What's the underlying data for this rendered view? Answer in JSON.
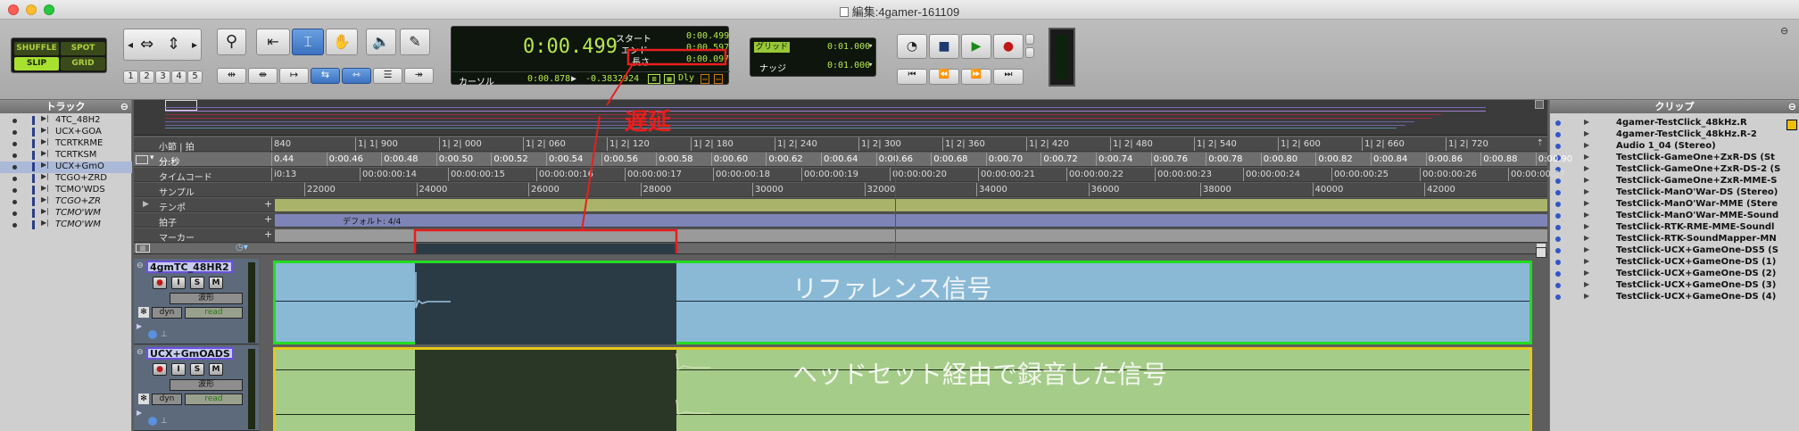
{
  "window": {
    "title": "編集:4gamer-161109"
  },
  "modes": {
    "shuffle": "SHUFFLE",
    "spot": "SPOT",
    "slip": "SLIP",
    "grid": "GRID"
  },
  "nudge_numbers": [
    "1",
    "2",
    "3",
    "4",
    "5"
  ],
  "counter": {
    "main": "0:00.499",
    "start_label": "スタート",
    "end_label": "エンド",
    "length_label": "長さ",
    "start": "0:00.499",
    "end": "0:00.597",
    "length": "0:00.097",
    "cursor_label": "カーソル",
    "cursor_time": "0:00.878",
    "cursor_value": "-0.3832924",
    "dly": "Dly"
  },
  "grid_nudge": {
    "grid_label": "グリッド",
    "grid_value": "0:01.000",
    "nudge_label": "ナッジ",
    "nudge_value": "0:01.000"
  },
  "tracks_panel": {
    "title": "トラック",
    "items": [
      "4TC_48H2",
      "UCX+GOA",
      "TCRTKRME",
      "TCRTKSM",
      "UCX+GmO",
      "TCGO+ZRD",
      "TCMO'WDS",
      "TCGO+ZR",
      "TCMO'WM",
      "TCMO'WM"
    ],
    "selected_index": 4
  },
  "clips_panel": {
    "title": "クリップ",
    "items": [
      "4gamer-TestClick_48kHz.R",
      "4gamer-TestClick_48kHz.R-2",
      "Audio 1_04 (Stereo)",
      "TestClick-GameOne+ZxR-DS (St",
      "TestClick-GameOne+ZxR-DS-2 (S",
      "TestClick-GameOne+ZxR-MME-S",
      "TestClick-ManO'War-DS (Stereo)",
      "TestClick-ManO'War-MME (Stere",
      "TestClick-ManO'War-MME-Sound",
      "TestClick-RTK-RME-MME-Soundl",
      "TestClick-RTK-SoundMapper-MN",
      "TestClick-UCX+GameOne-DS5 (S",
      "TestClick-UCX+GameOne-DS (1)",
      "TestClick-UCX+GameOne-DS (2)",
      "TestClick-UCX+GameOne-DS (3)",
      "TestClick-UCX+GameOne-DS (4)"
    ]
  },
  "rulers": {
    "bars_label": "小節 | 拍",
    "bars_ticks": [
      "840",
      "1| 1| 900",
      "1| 2| 000",
      "1| 2| 060",
      "1| 2| 120",
      "1| 2| 180",
      "1| 2| 240",
      "1| 2| 300",
      "1| 2| 360",
      "1| 2| 420",
      "1| 2| 480",
      "1| 2| 540",
      "1| 2| 600",
      "1| 2| 660",
      "1| 2| 720"
    ],
    "minsec_label": "分:秒",
    "minsec_ticks": [
      "0.44",
      "0:00.46",
      "0:00.48",
      "0:00.50",
      "0:00.52",
      "0:00.54",
      "0:00.56",
      "0:00.58",
      "0:00.60",
      "0:00.62",
      "0:00.64",
      "0:00.66",
      "0:00.68",
      "0:00.70",
      "0:00.72",
      "0:00.74",
      "0:00.76",
      "0:00.78",
      "0:00.80",
      "0:00.82",
      "0:00.84",
      "0:00.86",
      "0:00.88",
      "0:00.90"
    ],
    "timecode_label": "タイムコード",
    "timecode_ticks": [
      "i0:13",
      "00:00:00:14",
      "00:00:00:15",
      "00:00:00:16",
      "00:00:00:17",
      "00:00:00:18",
      "00:00:00:19",
      "00:00:00:20",
      "00:00:00:21",
      "00:00:00:22",
      "00:00:00:23",
      "00:00:00:24",
      "00:00:00:25",
      "00:00:00:26",
      "00:00:00:27"
    ],
    "samples_label": "サンプル",
    "samples_ticks": [
      "22000",
      "24000",
      "26000",
      "28000",
      "30000",
      "32000",
      "34000",
      "36000",
      "38000",
      "40000",
      "42000"
    ],
    "tempo_label": "テンポ",
    "meter_label": "拍子",
    "meter_value": "デフォルト: 4/4",
    "marker_label": "マーカー"
  },
  "track1": {
    "name": "4gmTC_48HR2",
    "view": "波形",
    "dyn": "dyn",
    "mode": "read",
    "annotation": "リファレンス信号"
  },
  "track2": {
    "name": "UCX+GmOADS",
    "view": "波形",
    "dyn": "dyn",
    "mode": "read",
    "annotation": "ヘッドセット経由で録音した信号"
  },
  "annotation_delay": "遅延",
  "buttons": {
    "i": "I",
    "s": "S",
    "m": "M"
  },
  "colors": {
    "ref_region": "#8ab9d6",
    "rec_region": "#a6cc8a",
    "selection": "#2b3b45",
    "annotation_red": "#e81e1e",
    "lcd_green": "#b8e848"
  }
}
